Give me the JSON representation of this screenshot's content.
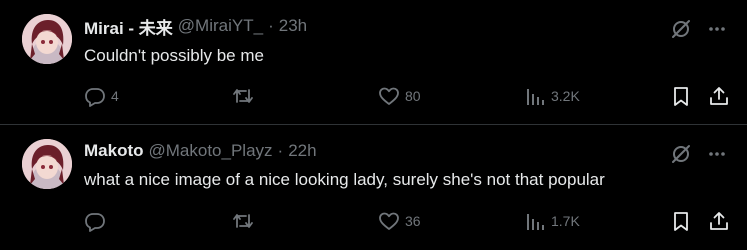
{
  "tweets": [
    {
      "name": "Mirai - 未来",
      "handle": "@MiraiYT_",
      "separator": "·",
      "time": "23h",
      "text": "Couldn't possibly be me",
      "replies": "4",
      "retweets": "",
      "likes": "80",
      "views": "3.2K"
    },
    {
      "name": "Makoto",
      "handle": "@Makoto_Playz",
      "separator": "·",
      "time": "22h",
      "text": "what a nice image of a nice looking lady, surely she's not that popular",
      "replies": "",
      "retweets": "",
      "likes": "36",
      "views": "1.7K"
    }
  ],
  "colors": {
    "background": "#000000",
    "text": "#e7e9ea",
    "muted": "#71767b",
    "divider": "#2f3336"
  },
  "icons": [
    "grok-icon",
    "more-icon",
    "reply-icon",
    "retweet-icon",
    "like-icon",
    "views-icon",
    "bookmark-icon",
    "share-icon"
  ]
}
